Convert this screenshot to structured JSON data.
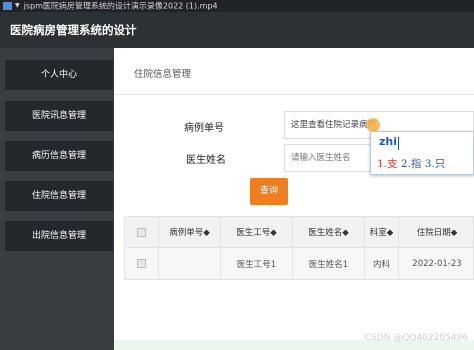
{
  "player": {
    "title": "jspm医院病房管理系统的设计演示录像2022 (1).mp4",
    "colors": {
      "bar": "#1f2226",
      "accent": "#4a8fe0"
    }
  },
  "app": {
    "title": "医院病房管理系统的设计"
  },
  "sidebar": {
    "items": [
      {
        "label": "个人中心"
      },
      {
        "label": "医院讯息管理"
      },
      {
        "label": "病历信息管理"
      },
      {
        "label": "住院信息管理"
      },
      {
        "label": "出院信息管理"
      }
    ]
  },
  "main": {
    "page_title": "住院信息管理",
    "form": {
      "case_number_label": "病例单号",
      "case_number_value": "这里查看住院记录病例",
      "doctor_name_label": "医生姓名",
      "doctor_name_placeholder": "请输入医生姓名",
      "search_label": "查询"
    },
    "table": {
      "headers": [
        "病例单号◆",
        "医生工号◆",
        "医生姓名◆",
        "科室◆",
        "住院日期◆"
      ],
      "rows": [
        [
          "",
          "医生工号1",
          "医生姓名1",
          "内科",
          "2022-01-23"
        ]
      ]
    }
  },
  "ime": {
    "input": "zhi",
    "candidates_first": "1.支",
    "candidates_rest": " 2.指  3.只"
  },
  "watermark": "CSDN @QQ402205496",
  "colors": {
    "header_bg": "#2c3136",
    "sidebar_bg": "#393d42",
    "menu_item_bg": "#24272b",
    "search_button": "#f07d1e"
  }
}
